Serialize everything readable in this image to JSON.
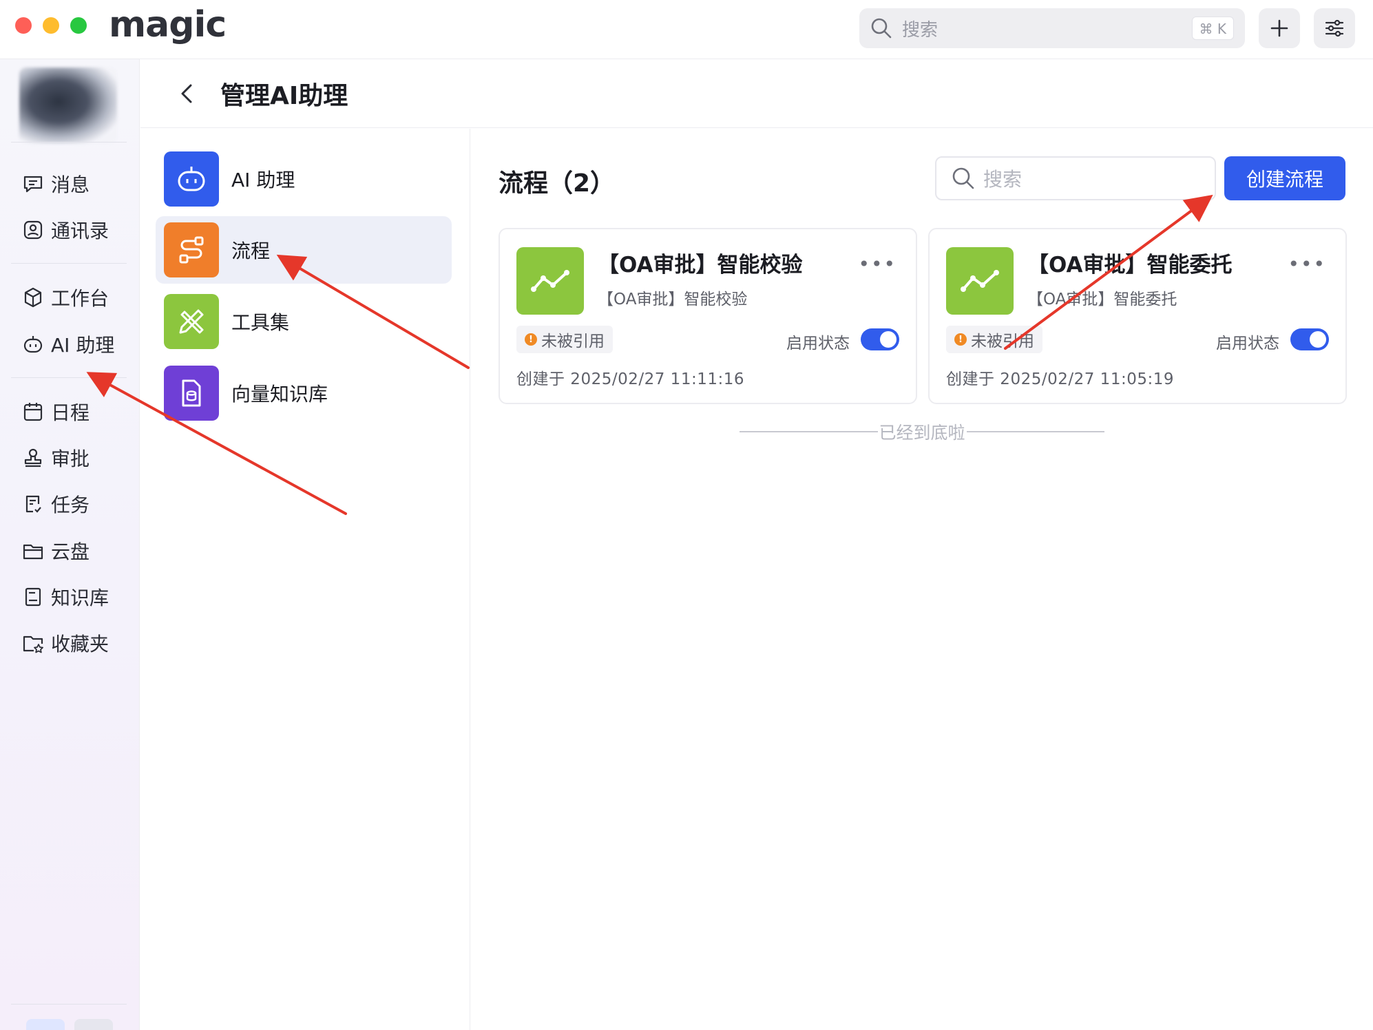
{
  "app": {
    "logo_text": "magic",
    "search_placeholder": "搜索",
    "search_shortcut": "⌘ K",
    "icons": {
      "plus": "plus-icon",
      "settings": "sliders-icon"
    }
  },
  "sidebar": {
    "items_group1": [
      {
        "label": "消息",
        "icon": "message-icon"
      },
      {
        "label": "通讯录",
        "icon": "contacts-icon"
      }
    ],
    "items_group2": [
      {
        "label": "工作台",
        "icon": "cube-icon"
      },
      {
        "label": "AI 助理",
        "icon": "robot-icon"
      }
    ],
    "items_group3": [
      {
        "label": "日程",
        "icon": "calendar-icon"
      },
      {
        "label": "审批",
        "icon": "stamp-icon"
      },
      {
        "label": "任务",
        "icon": "task-icon"
      },
      {
        "label": "云盘",
        "icon": "folder-icon"
      },
      {
        "label": "知识库",
        "icon": "book-icon"
      },
      {
        "label": "收藏夹",
        "icon": "favorite-folder-icon"
      }
    ]
  },
  "header": {
    "title": "管理AI助理"
  },
  "categories": [
    {
      "label": "AI 助理",
      "color": "#315cec",
      "icon": "robot-icon",
      "active": false
    },
    {
      "label": "流程",
      "color": "#f07e2a",
      "icon": "flow-icon",
      "active": true
    },
    {
      "label": "工具集",
      "color": "#8cc63e",
      "icon": "tools-icon",
      "active": false
    },
    {
      "label": "向量知识库",
      "color": "#6f3fd6",
      "icon": "database-file-icon",
      "active": false
    }
  ],
  "main": {
    "title": "流程（2）",
    "search_placeholder": "搜索",
    "create_button": "创建流程",
    "status_label": "启用状态",
    "end_text": "已经到底啦",
    "flows": [
      {
        "title": "【OA审批】智能校验",
        "subtitle": "【OA审批】智能校验",
        "badge": "未被引用",
        "enabled": true,
        "created": "创建于 2025/02/27 11:11:16"
      },
      {
        "title": "【OA审批】智能委托",
        "subtitle": "【OA审批】智能委托",
        "badge": "未被引用",
        "enabled": true,
        "created": "创建于 2025/02/27 11:05:19"
      }
    ]
  },
  "colors": {
    "accent": "#315cec",
    "flow_icon_bg": "#8cc63e",
    "warning": "#f08a24",
    "annotation_arrow": "#e5372a"
  }
}
